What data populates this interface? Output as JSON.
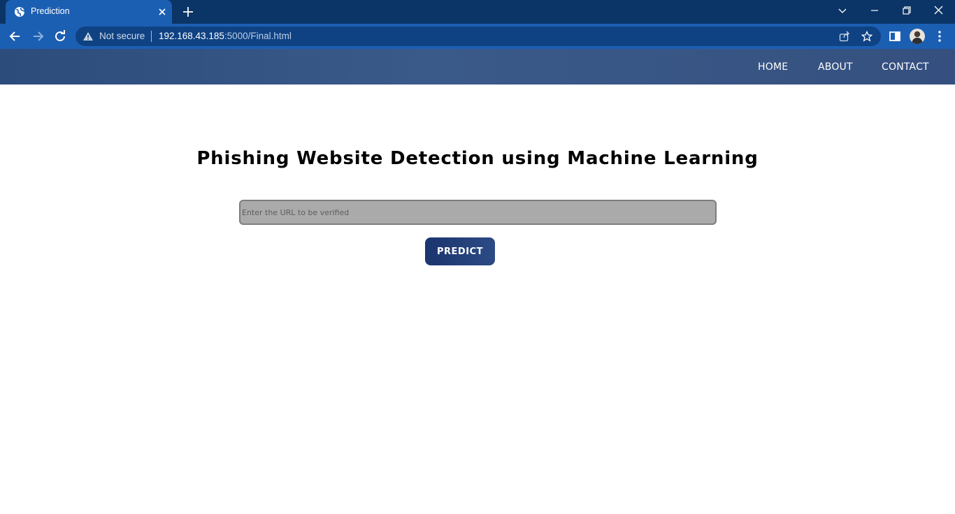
{
  "browser": {
    "tab": {
      "title": "Prediction"
    },
    "address": {
      "security_label": "Not secure",
      "url_host": "192.168.43.185",
      "url_rest": ":5000/Final.html"
    }
  },
  "site": {
    "nav": {
      "items": [
        "HOME",
        "ABOUT",
        "CONTACT"
      ]
    },
    "title": "Phishing Website Detection using Machine Learning",
    "input": {
      "placeholder": "Enter the URL to be verified",
      "value": ""
    },
    "button": {
      "label": "PREDICT"
    }
  },
  "colors": {
    "tabbar": "#0b3566",
    "toolbar": "#1b5fb3",
    "site_nav": "#3a5a8a",
    "button": "#1b356d",
    "input_bg": "#aaaaaa"
  },
  "icons": [
    "globe-icon",
    "close-icon",
    "plus-icon",
    "chevron-down-icon",
    "minimize-icon",
    "restore-icon",
    "window-close-icon",
    "back-arrow-icon",
    "forward-arrow-icon",
    "reload-icon",
    "warning-icon",
    "share-icon",
    "star-icon",
    "side-panel-icon",
    "avatar",
    "kebab-menu-icon"
  ]
}
